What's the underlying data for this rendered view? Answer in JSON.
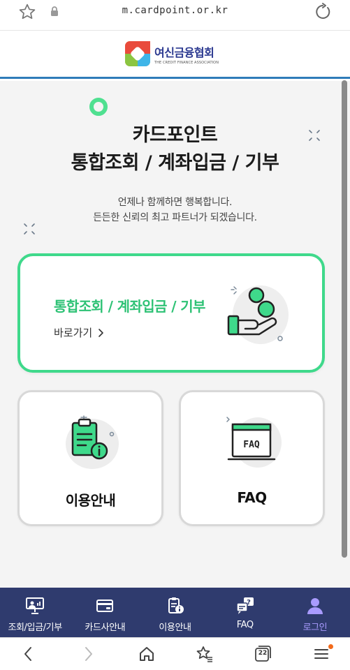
{
  "browser": {
    "url": "m.cardpoint.or.kr",
    "tab_count": "22"
  },
  "header": {
    "logo_name": "여신금융협회",
    "logo_sub": "THE CREDIT FINANCE ASSOCIATION"
  },
  "hero": {
    "title_line1": "카드포인트",
    "title_line2": "통합조회 / 계좌입금 / 기부",
    "desc_line1": "언제나 함께하면 행복합니다.",
    "desc_line2": "든든한 신뢰의 최고 파트너가 되겠습니다."
  },
  "main_card": {
    "title": "통합조회 / 계좌입금 / 기부",
    "link_label": "바로가기"
  },
  "cards": {
    "guide_label": "이용안내",
    "faq_label": "FAQ",
    "faq_sign": "FAQ"
  },
  "nav": {
    "items": [
      {
        "label": "조회/입금/기부",
        "icon": "presentation-icon"
      },
      {
        "label": "카드사안내",
        "icon": "card-icon"
      },
      {
        "label": "이용안내",
        "icon": "info-doc-icon"
      },
      {
        "label": "FAQ",
        "icon": "question-chat-icon"
      },
      {
        "label": "로그인",
        "icon": "user-icon"
      }
    ]
  },
  "colors": {
    "accent_green": "#3fd98b",
    "nav_bg": "#2f3b6e",
    "active_nav": "#a99bff",
    "header_line": "#2f7cb9"
  }
}
